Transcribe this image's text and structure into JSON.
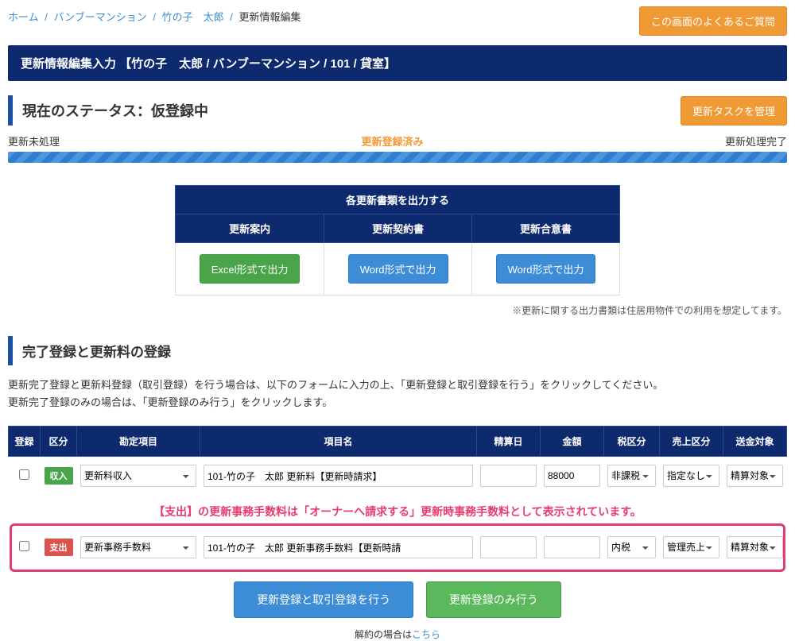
{
  "breadcrumb": {
    "items": [
      "ホーム",
      "バンブーマンション",
      "竹の子　太郎",
      "更新情報編集"
    ]
  },
  "faq_label": "この画面のよくあるご質問",
  "page_title": "更新情報編集入力 【竹の子　太郎 / バンブーマンション / 101 / 貸室】",
  "status": {
    "label": "現在のステータス：仮登録中",
    "manage_btn": "更新タスクを管理",
    "progress_left": "更新未処理",
    "progress_center": "更新登録済み",
    "progress_right": "更新処理完了"
  },
  "docs": {
    "group_header": "各更新書類を出力する",
    "col1": "更新案内",
    "col2": "更新契約書",
    "col3": "更新合意書",
    "btn1": "Excel形式で出力",
    "btn2": "Word形式で出力",
    "btn3": "Word形式で出力",
    "note": "※更新に関する出力書類は住居用物件での利用を想定してます。"
  },
  "section": {
    "title": "完了登録と更新料の登録",
    "desc1": "更新完了登録と更新料登録（取引登録）を行う場合は、以下のフォームに入力の上、「更新登録と取引登録を行う」をクリックしてください。",
    "desc2": "更新完了登録のみの場合は、「更新登録のみ行う」をクリックします。"
  },
  "table": {
    "headers": [
      "登録",
      "区分",
      "勘定項目",
      "項目名",
      "精算日",
      "金額",
      "税区分",
      "売上区分",
      "送金対象"
    ],
    "rows": [
      {
        "kubun": "収入",
        "kubun_class": "in",
        "account": "更新料収入",
        "name": "101-竹の子　太郎 更新料【更新時請求】",
        "date": "",
        "amount": "88000",
        "tax": "非課税",
        "sales": "指定なし",
        "send": "精算対象"
      },
      {
        "kubun": "支出",
        "kubun_class": "out",
        "account": "更新事務手数料",
        "name": "101-竹の子　太郎 更新事務手数料【更新時請",
        "date": "",
        "amount": "",
        "tax": "内税",
        "sales": "管理売上",
        "send": "精算対象"
      }
    ]
  },
  "annotation": "【支出】の更新事務手数料は「オーナーへ請求する」更新時事務手数料として表示されています。",
  "actions": {
    "primary": "更新登録と取引登録を行う",
    "success": "更新登録のみ行う",
    "cancel_prefix": "解約の場合は",
    "cancel_link": "こちら"
  }
}
